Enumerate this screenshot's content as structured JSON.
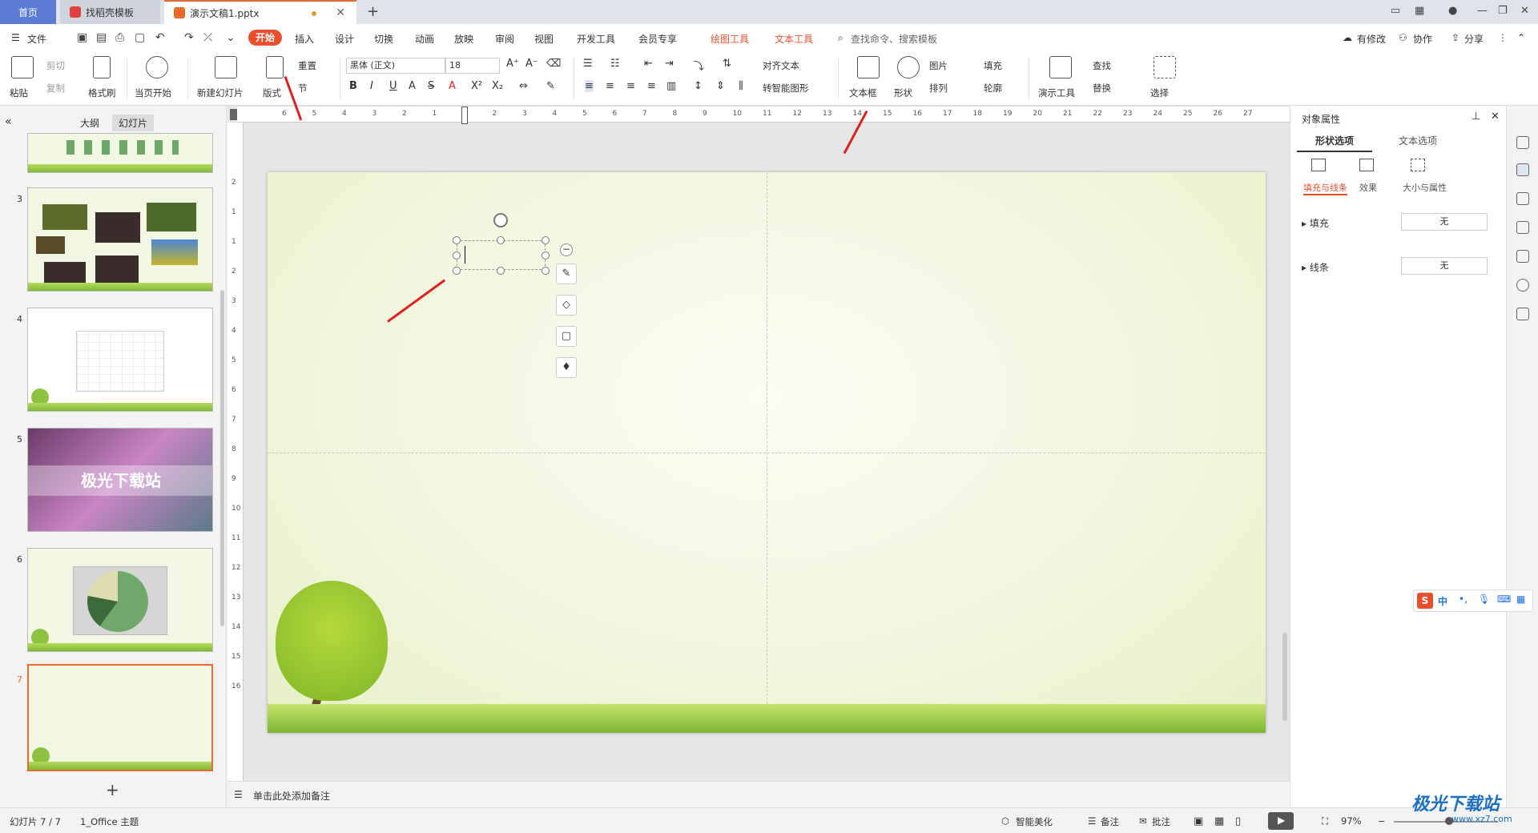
{
  "tabs": {
    "home": "首页",
    "template": "找稻壳模板",
    "document": "演示文稿1.pptx",
    "new_tab": "+"
  },
  "menu": {
    "file": "文件",
    "start": "开始",
    "insert": "插入",
    "design": "设计",
    "transition": "切换",
    "animation": "动画",
    "slideshow": "放映",
    "review": "审阅",
    "view": "视图",
    "developer": "开发工具",
    "member": "会员专享",
    "drawing_tools": "绘图工具",
    "text_tools": "文本工具",
    "search": "查找命令、搜索模板",
    "has_changes": "有修改",
    "collaborate": "协作",
    "share": "分享"
  },
  "ribbon": {
    "paste": "粘贴",
    "cut": "剪切",
    "copy": "复制",
    "format_painter": "格式刷",
    "from_current": "当页开始",
    "new_slide": "新建幻灯片",
    "layout": "版式",
    "reset": "重置",
    "section": "节",
    "font_name": "黑体 (正文)",
    "font_size": "18",
    "align_text": "对齐文本",
    "smart_shape": "转智能图形",
    "text_box": "文本框",
    "shape": "形状",
    "picture": "图片",
    "fill": "填充",
    "arrange": "排列",
    "outline": "轮廓",
    "present_tools": "演示工具",
    "find": "查找",
    "replace": "替换",
    "select": "选择"
  },
  "left_panel": {
    "outline_tab": "大纲",
    "slides_tab": "幻灯片",
    "slide_numbers": [
      "3",
      "4",
      "5",
      "6",
      "7"
    ],
    "slide5_title": "极光下载站",
    "add_slide": "+"
  },
  "notes": {
    "placeholder": "单击此处添加备注"
  },
  "right_panel": {
    "title": "对象属性",
    "tab_shape": "形状选项",
    "tab_text": "文本选项",
    "sub_fill_line": "填充与线条",
    "sub_effect": "效果",
    "sub_size": "大小与属性",
    "fill_label": "填充",
    "fill_value": "无",
    "line_label": "线条",
    "line_value": "无"
  },
  "status": {
    "slide_info": "幻灯片 7 / 7",
    "theme": "1_Office 主题",
    "smart_beautify": "智能美化",
    "notes": "备注",
    "comments": "批注",
    "zoom": "97%"
  },
  "watermark": "极光下载站",
  "watermark_url": "www.xz7.com",
  "ime": {
    "label": "中"
  },
  "ruler": {
    "h_ticks": [
      "6",
      "5",
      "4",
      "3",
      "2",
      "1",
      "1",
      "2",
      "3",
      "4",
      "5",
      "6",
      "7",
      "8",
      "9",
      "10",
      "11",
      "12",
      "13",
      "14",
      "15",
      "16",
      "17",
      "18",
      "19",
      "20",
      "21",
      "22",
      "23",
      "24",
      "25",
      "26",
      "27"
    ],
    "v_ticks": [
      "2",
      "1",
      "1",
      "2",
      "3",
      "4",
      "5",
      "6",
      "7",
      "8",
      "9",
      "10",
      "11",
      "12",
      "13",
      "14",
      "15",
      "16"
    ]
  },
  "colors": {
    "accent": "#e84f2d",
    "tab_active": "#5b7bd5",
    "annotation_arrow": "#e02020"
  }
}
